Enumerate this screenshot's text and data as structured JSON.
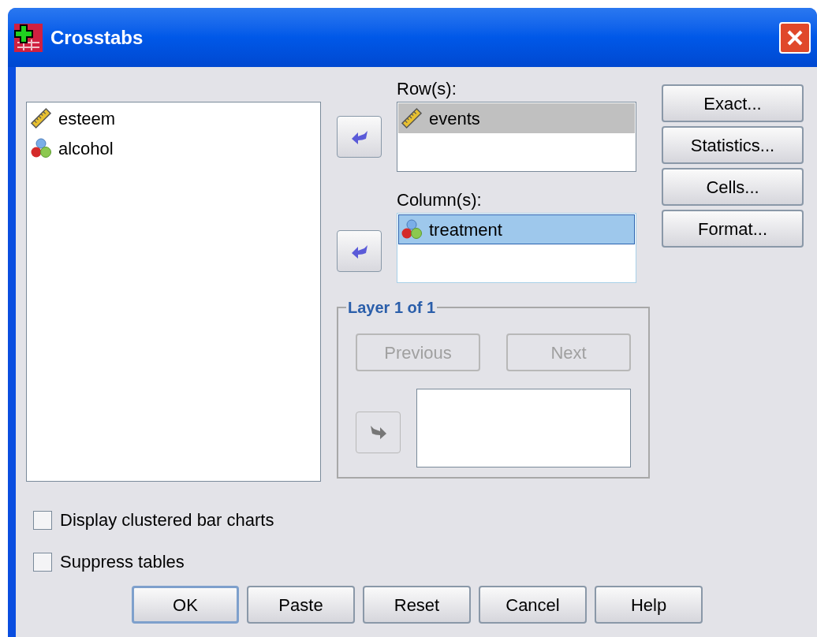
{
  "window": {
    "title": "Crosstabs"
  },
  "source_list": {
    "focused": false,
    "items": [
      {
        "label": "esteem",
        "kind": "scale",
        "selected": false
      },
      {
        "label": "alcohol",
        "kind": "nominal",
        "selected": false
      }
    ]
  },
  "rows": {
    "label": "Row(s):",
    "focused": false,
    "items": [
      {
        "label": "events",
        "kind": "scale",
        "selected": true
      }
    ]
  },
  "columns": {
    "label": "Column(s):",
    "focused": true,
    "items": [
      {
        "label": "treatment",
        "kind": "nominal",
        "selected": true
      }
    ]
  },
  "side_buttons": [
    {
      "label": "Exact..."
    },
    {
      "label": "Statistics..."
    },
    {
      "label": "Cells..."
    },
    {
      "label": "Format..."
    }
  ],
  "layer": {
    "legend": "Layer 1 of 1",
    "previous": {
      "label": "Previous",
      "disabled": true
    },
    "next": {
      "label": "Next",
      "disabled": true
    },
    "move_disabled": true
  },
  "checkboxes": [
    {
      "label": "Display clustered bar charts",
      "checked": false
    },
    {
      "label": "Suppress tables",
      "checked": false
    }
  ],
  "buttons": [
    {
      "label": "OK",
      "default": true
    },
    {
      "label": "Paste",
      "default": false
    },
    {
      "label": "Reset",
      "default": false
    },
    {
      "label": "Cancel",
      "default": false
    },
    {
      "label": "Help",
      "default": false
    }
  ]
}
